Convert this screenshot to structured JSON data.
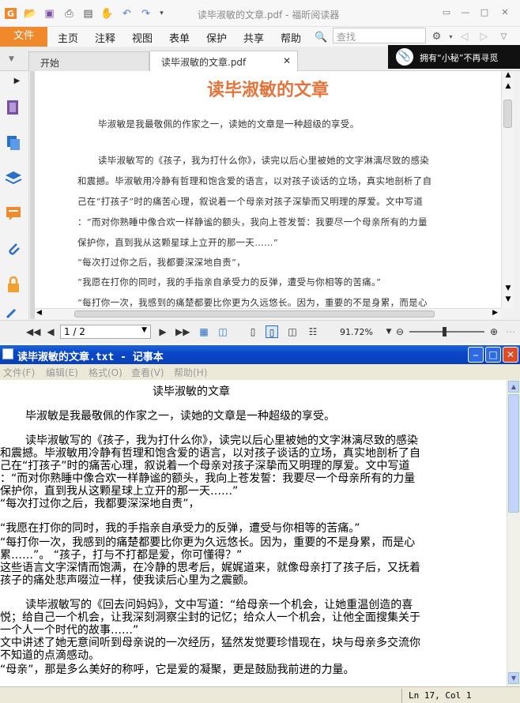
{
  "foxit": {
    "window_title": "读毕淑敏的文章.pdf - 福昕阅读器",
    "menu": [
      "文件",
      "主页",
      "注释",
      "视图",
      "表单",
      "保护",
      "共享",
      "帮助"
    ],
    "search_placeholder": "查找",
    "tabs": [
      {
        "label": "开始"
      },
      {
        "label": "读毕淑敏的文章.pdf"
      }
    ],
    "ad_text": "拥有“小秘”不再寻觅",
    "document": {
      "title": "读毕淑敏的文章",
      "lines": [
        "毕淑敏是我最敬佩的作家之一，读她的文章是一种超级的享受。",
        "读毕淑敏写的《孩子，我为打什么你》，读完以后心里被她的文字淋漓尽致的感染",
        "和震撼。毕淑敏用冷静有哲理和饱含爱的语言，以对孩子谈话的立场，真实地剖析了自",
        "己在“打孩子”时的痛苦心理，叙说着一个母亲对孩子深挚而又明理的厚爱。文中写道",
        "：“而对你熟睡中像合欢一样静谧的额头，我向上苍发誓：我要尽一个母亲所有的力量",
        "保护你，直到我从这颗星球上立开的那一天……”",
        "“每次打过你之后，我都要深深地自责”，",
        "“我愿在打你的同时，我的手指亲自承受力的反弹，遭受与你相等的苦痛。”",
        "“每打你一次，我感到的痛楚都要比你更为久远悠长。因为，重要的不是身累，而是心"
      ]
    },
    "page_indicator": "1 / 2",
    "zoom": "91.72%"
  },
  "notepad": {
    "window_title": "读毕淑敏的文章.txt - 记事本",
    "menu": [
      "文件(F)",
      "编辑(E)",
      "格式(O)",
      "查看(V)",
      "帮助(H)"
    ],
    "lines": [
      "                    读毕淑敏的文章",
      "",
      "    毕淑敏是我最敬佩的作家之一，读她的文章是一种超级的享受。",
      "",
      "    读毕淑敏写的《孩子，我为打什么你》，读完以后心里被她的文字淋漓尽致的感染",
      "和震撼。毕淑敏用冷静有哲理和饱含爱的语言，以对孩子谈话的立场，真实地剖析了自",
      "己在“打孩子”时的痛苦心理，叙说着一个母亲对孩子深挚而又明理的厚爱。文中写道",
      "：“而对你熟睡中像合欢一样静谧的额头，我向上苍发誓：我要尽一个母亲所有的力量",
      "保护你，直到我从这颗星球上立开的那一天……”",
      "“每次打过你之后，我都要深深地自责”，",
      "",
      "“我愿在打你的同时，我的手指亲自承受力的反弹，遭受与你相等的苦痛。”",
      "“每打你一次，我感到的痛楚都要比你更为久远悠长。因为，重要的不是身累，而是心",
      "累……”。  “孩子，打与不打都是爱，你可懂得？”",
      "这些语言文字深情而饱满，在冷静的思考后，娓娓道来，就像母亲打了孩子后，又抚着",
      "孩子的痛处悲声啜泣一样，使我读后心里为之震颤。",
      "",
      "    读毕淑敏写的《回去问妈妈》，文中写道：“给母亲一个机会，让她重温创造的喜",
      "悦；给自己一个机会，让我深刻洞察尘封的记忆；给众人一个机会，让他全面搜集关于",
      "一个人一个时代的故事……”",
      "文中讲述了她无意间听到母亲说的一次经历，猛然发觉要珍惜现在，块与母亲多交流你",
      "不知道的点滴感动。",
      "“母亲”，那是多么美好的称呼，它是爱的凝聚，更是鼓励我前进的力量。"
    ],
    "status_position": "Ln 17, Col 1"
  }
}
